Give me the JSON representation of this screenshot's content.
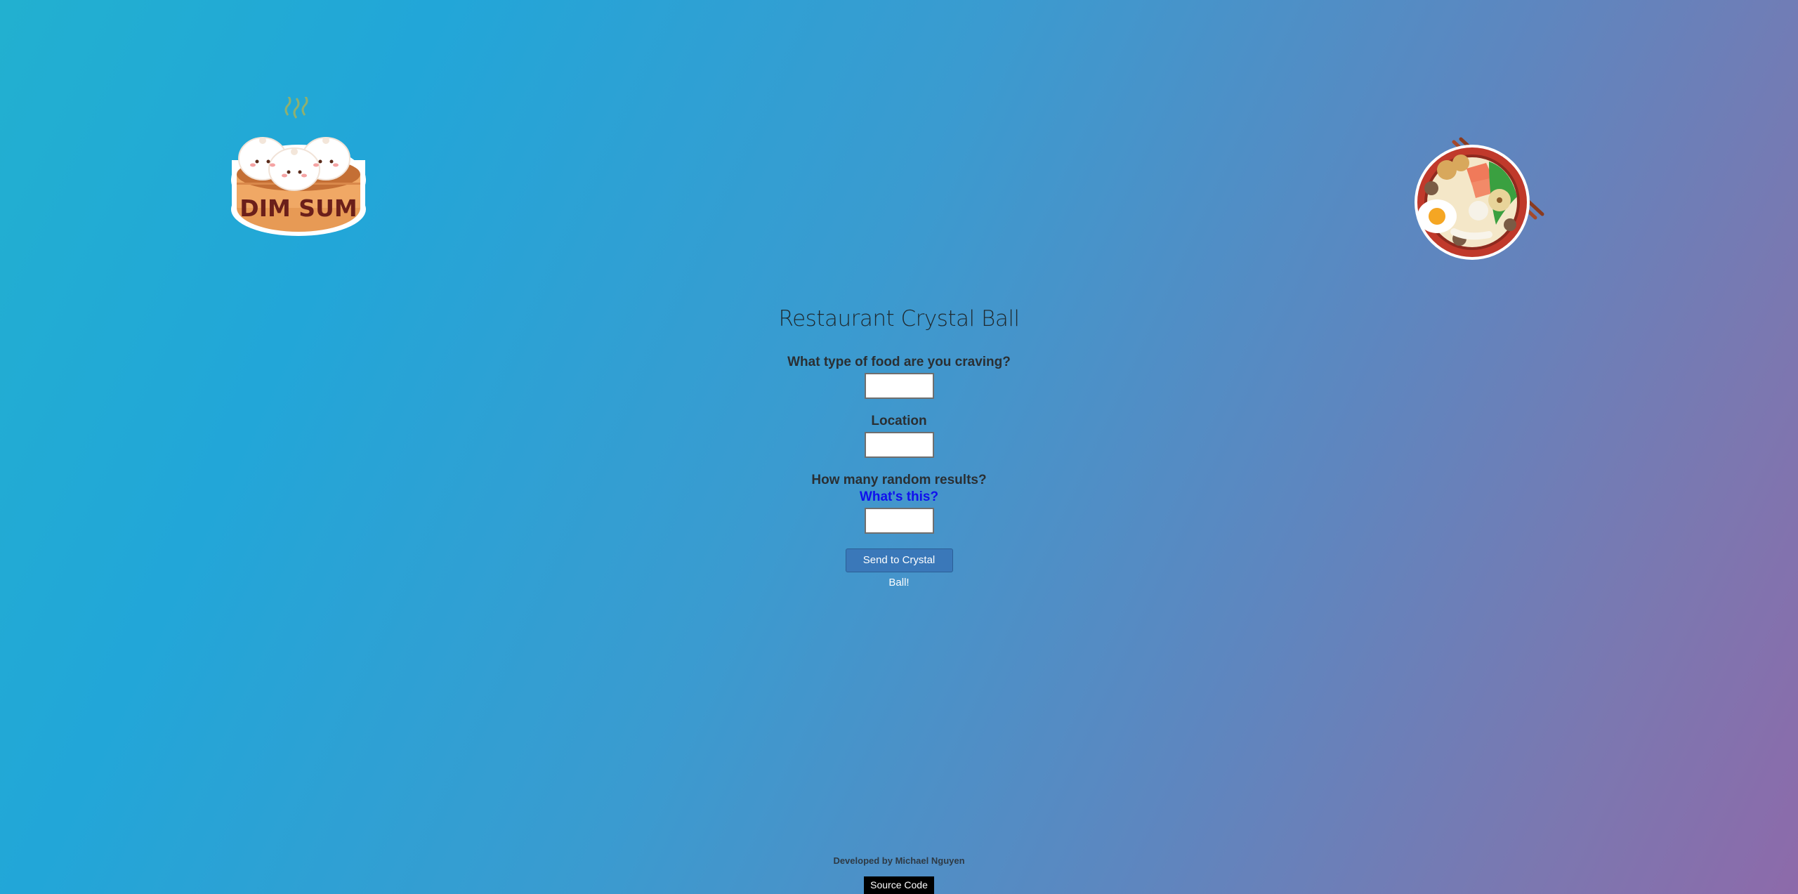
{
  "header": {
    "left_logo": {
      "icon": "dim-sum-logo-icon",
      "text": "DIM SUM"
    },
    "right_logo": {
      "icon": "noodle-bowl-icon"
    }
  },
  "main": {
    "title": "Restaurant Crystal Ball",
    "food_label": "What type of food are you craving?",
    "food_value": "",
    "location_label": "Location",
    "location_value": "",
    "results_label": "How many random results?",
    "results_help": "What's this?",
    "results_value": "",
    "submit_label": "Send to Crystal Ball!"
  },
  "footer": {
    "credit": "Developed by Michael Nguyen",
    "source_label": "Source Code"
  }
}
